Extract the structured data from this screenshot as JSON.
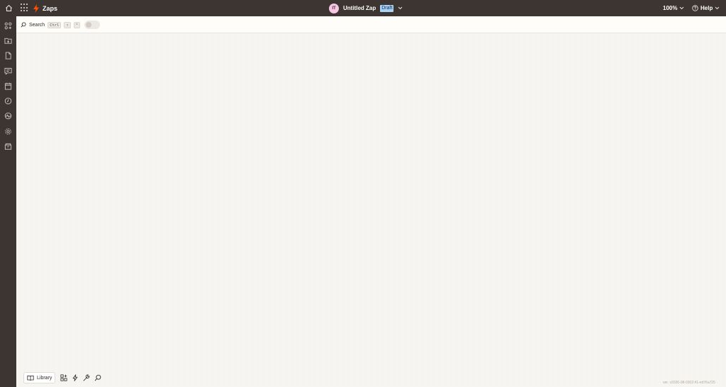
{
  "topbar": {
    "brand": "Zaps",
    "zap_avatar_initials": "IT",
    "zap_name": "Untitled Zap",
    "status_badge": "Draft",
    "zoom_level": "100%",
    "help_label": "Help"
  },
  "sidebar": {
    "items": [
      {
        "icon": "home-icon"
      },
      {
        "icon": "apps-icon"
      },
      {
        "icon": "folder-icon"
      },
      {
        "icon": "document-icon"
      },
      {
        "icon": "chat-icon"
      },
      {
        "icon": "calendar-icon"
      },
      {
        "icon": "history-icon"
      },
      {
        "icon": "activity-icon"
      },
      {
        "icon": "settings-icon"
      },
      {
        "icon": "archive-icon"
      }
    ],
    "assistant_icon": "sparkle-icon"
  },
  "search": {
    "label": "Search",
    "shortcut_key1": "Ctrl",
    "shortcut_key2": "⇧",
    "shortcut_key3": "⌃"
  },
  "bottom_toolbar": {
    "library_label": "Library",
    "tools": [
      "add-apps-icon",
      "bolt-icon",
      "wrench-icon",
      "search-icon"
    ]
  },
  "version_text": "ver. v2026-08-0302:41-ed76a725",
  "colors": {
    "chrome": "#3c3532",
    "canvas": "#f7f5f2",
    "brand_orange": "#ff4f00",
    "draft_badge": "#a9d3f5",
    "assistant": "#6f5bd6"
  }
}
